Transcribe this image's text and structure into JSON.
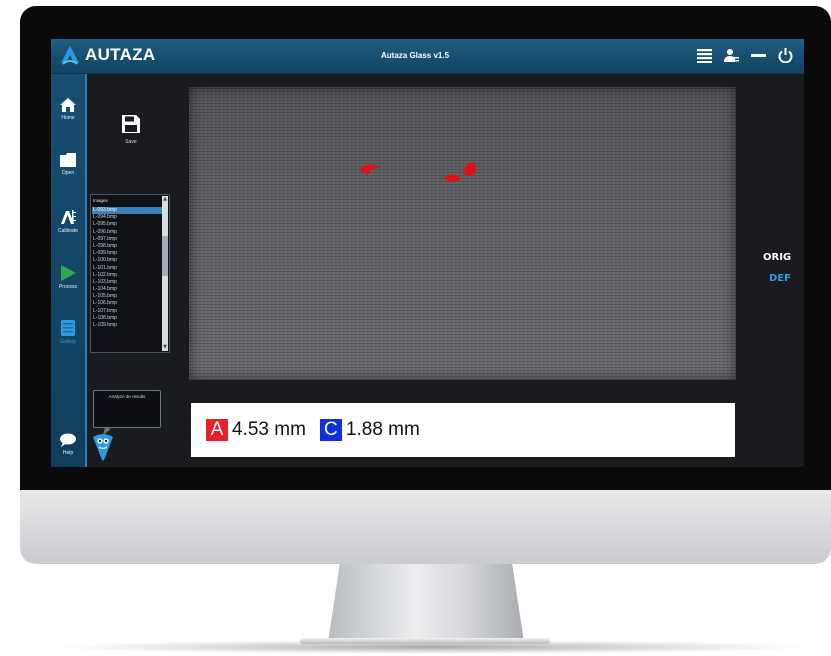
{
  "app": {
    "brand": "AUTAZA",
    "title": "Autaza Glass v1.5"
  },
  "titlebar_icons": [
    "list-icon",
    "user-settings-icon",
    "minimize-icon",
    "power-icon"
  ],
  "nav": {
    "items": [
      {
        "label": "Home",
        "icon": "home-icon"
      },
      {
        "label": "Open",
        "icon": "folder-icon"
      },
      {
        "label": "Calibrate",
        "icon": "calibrate-icon"
      },
      {
        "label": "Process",
        "icon": "play-icon"
      },
      {
        "label": "Gallery",
        "icon": "gallery-icon"
      },
      {
        "label": "Help",
        "icon": "chat-icon"
      }
    ]
  },
  "toolbar": {
    "save_label": "Save"
  },
  "images_panel": {
    "header": "Images",
    "items": [
      "L-093.bmp",
      "L-094.bmp",
      "L-095.bmp",
      "L-096.bmp",
      "L-097.bmp",
      "L-098.bmp",
      "L-099.bmp",
      "L-100.bmp",
      "L-101.bmp",
      "L-102.bmp",
      "L-103.bmp",
      "L-104.bmp",
      "L-105.bmp",
      "L-106.bmp",
      "L-107.bmp",
      "L-108.bmp",
      "L-109.bmp"
    ],
    "selected_index": 0
  },
  "view_options": {
    "orig": "ORIG",
    "def": "DEF",
    "active": "DEF"
  },
  "measurements": [
    {
      "tag": "A",
      "value": "4.53 mm",
      "color": "#e8202a"
    },
    {
      "tag": "C",
      "value": "1.88 mm",
      "color": "#1030e0"
    }
  ],
  "assistant": {
    "text": "Analyze de results"
  },
  "colors": {
    "titlebar": "#1b557a",
    "nav": "#164d6e",
    "accent": "#2d9be0",
    "defect": "#e0101a"
  }
}
